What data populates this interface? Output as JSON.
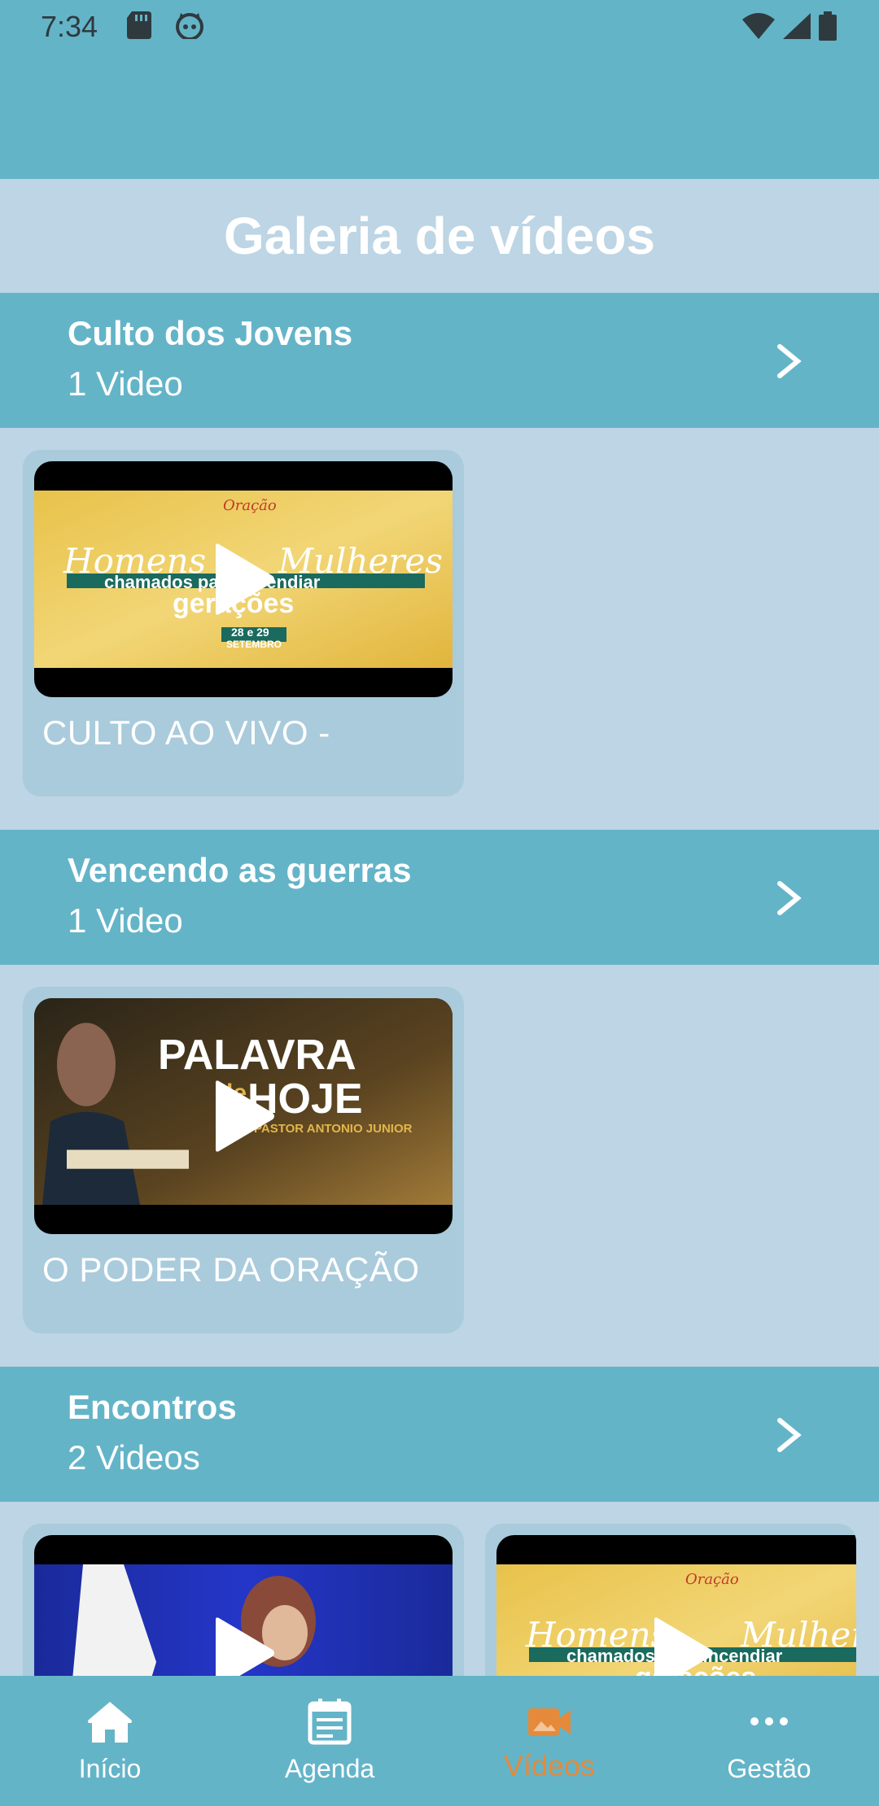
{
  "status_bar": {
    "time": "7:34",
    "left_icons": [
      "sd-card-icon",
      "cat-face-icon"
    ],
    "right_icons": [
      "wifi-icon",
      "signal-icon",
      "battery-icon"
    ]
  },
  "page": {
    "title": "Galeria de vídeos"
  },
  "sections": [
    {
      "title": "Culto dos Jovens",
      "count": "1 Video",
      "videos": [
        {
          "title": "CULTO AO VIVO -",
          "thumbnail": "Homens Mulheres chamados para incendiar gerações 28 e 29 SETEMBRO"
        }
      ]
    },
    {
      "title": "Vencendo as guerras",
      "count": "1 Video",
      "videos": [
        {
          "title": "O PODER DA ORAÇÃO",
          "thumbnail": "PALAVRA de HOJE PASTOR ANTONIO JUNIOR"
        }
      ]
    },
    {
      "title": "Encontros",
      "count": "2 Videos",
      "videos": [
        {
          "title": "",
          "thumbnail": "woman-preaching"
        },
        {
          "title": "",
          "thumbnail": "Homens Mulheres chamados para incendiar gerações"
        }
      ]
    }
  ],
  "thumb_text": {
    "homens": "Homens",
    "mulheres": "Mulheres",
    "chamados": "chamados para incendiar",
    "geracoes": "gerações",
    "date": "28 e 29",
    "setembro": "SETEMBRO",
    "palavra": "PALAVRA",
    "hoje": "HOJE",
    "de": "de",
    "pastor": "PASTOR ANTONIO JUNIOR",
    "oracao_logo": "Oração"
  },
  "bottom_nav": {
    "items": [
      {
        "label": "Início",
        "icon": "home-icon",
        "active": false
      },
      {
        "label": "Agenda",
        "icon": "calendar-icon",
        "active": false
      },
      {
        "label": "Vídeos",
        "icon": "video-camera-icon",
        "active": true
      },
      {
        "label": "Gestão",
        "icon": "more-dots-icon",
        "active": false
      }
    ]
  },
  "colors": {
    "primary": "#64b4c8",
    "background": "#bdd5e4",
    "card": "#a9cbdc",
    "accent_active": "#e58a3a",
    "text_light": "#ffffff"
  }
}
